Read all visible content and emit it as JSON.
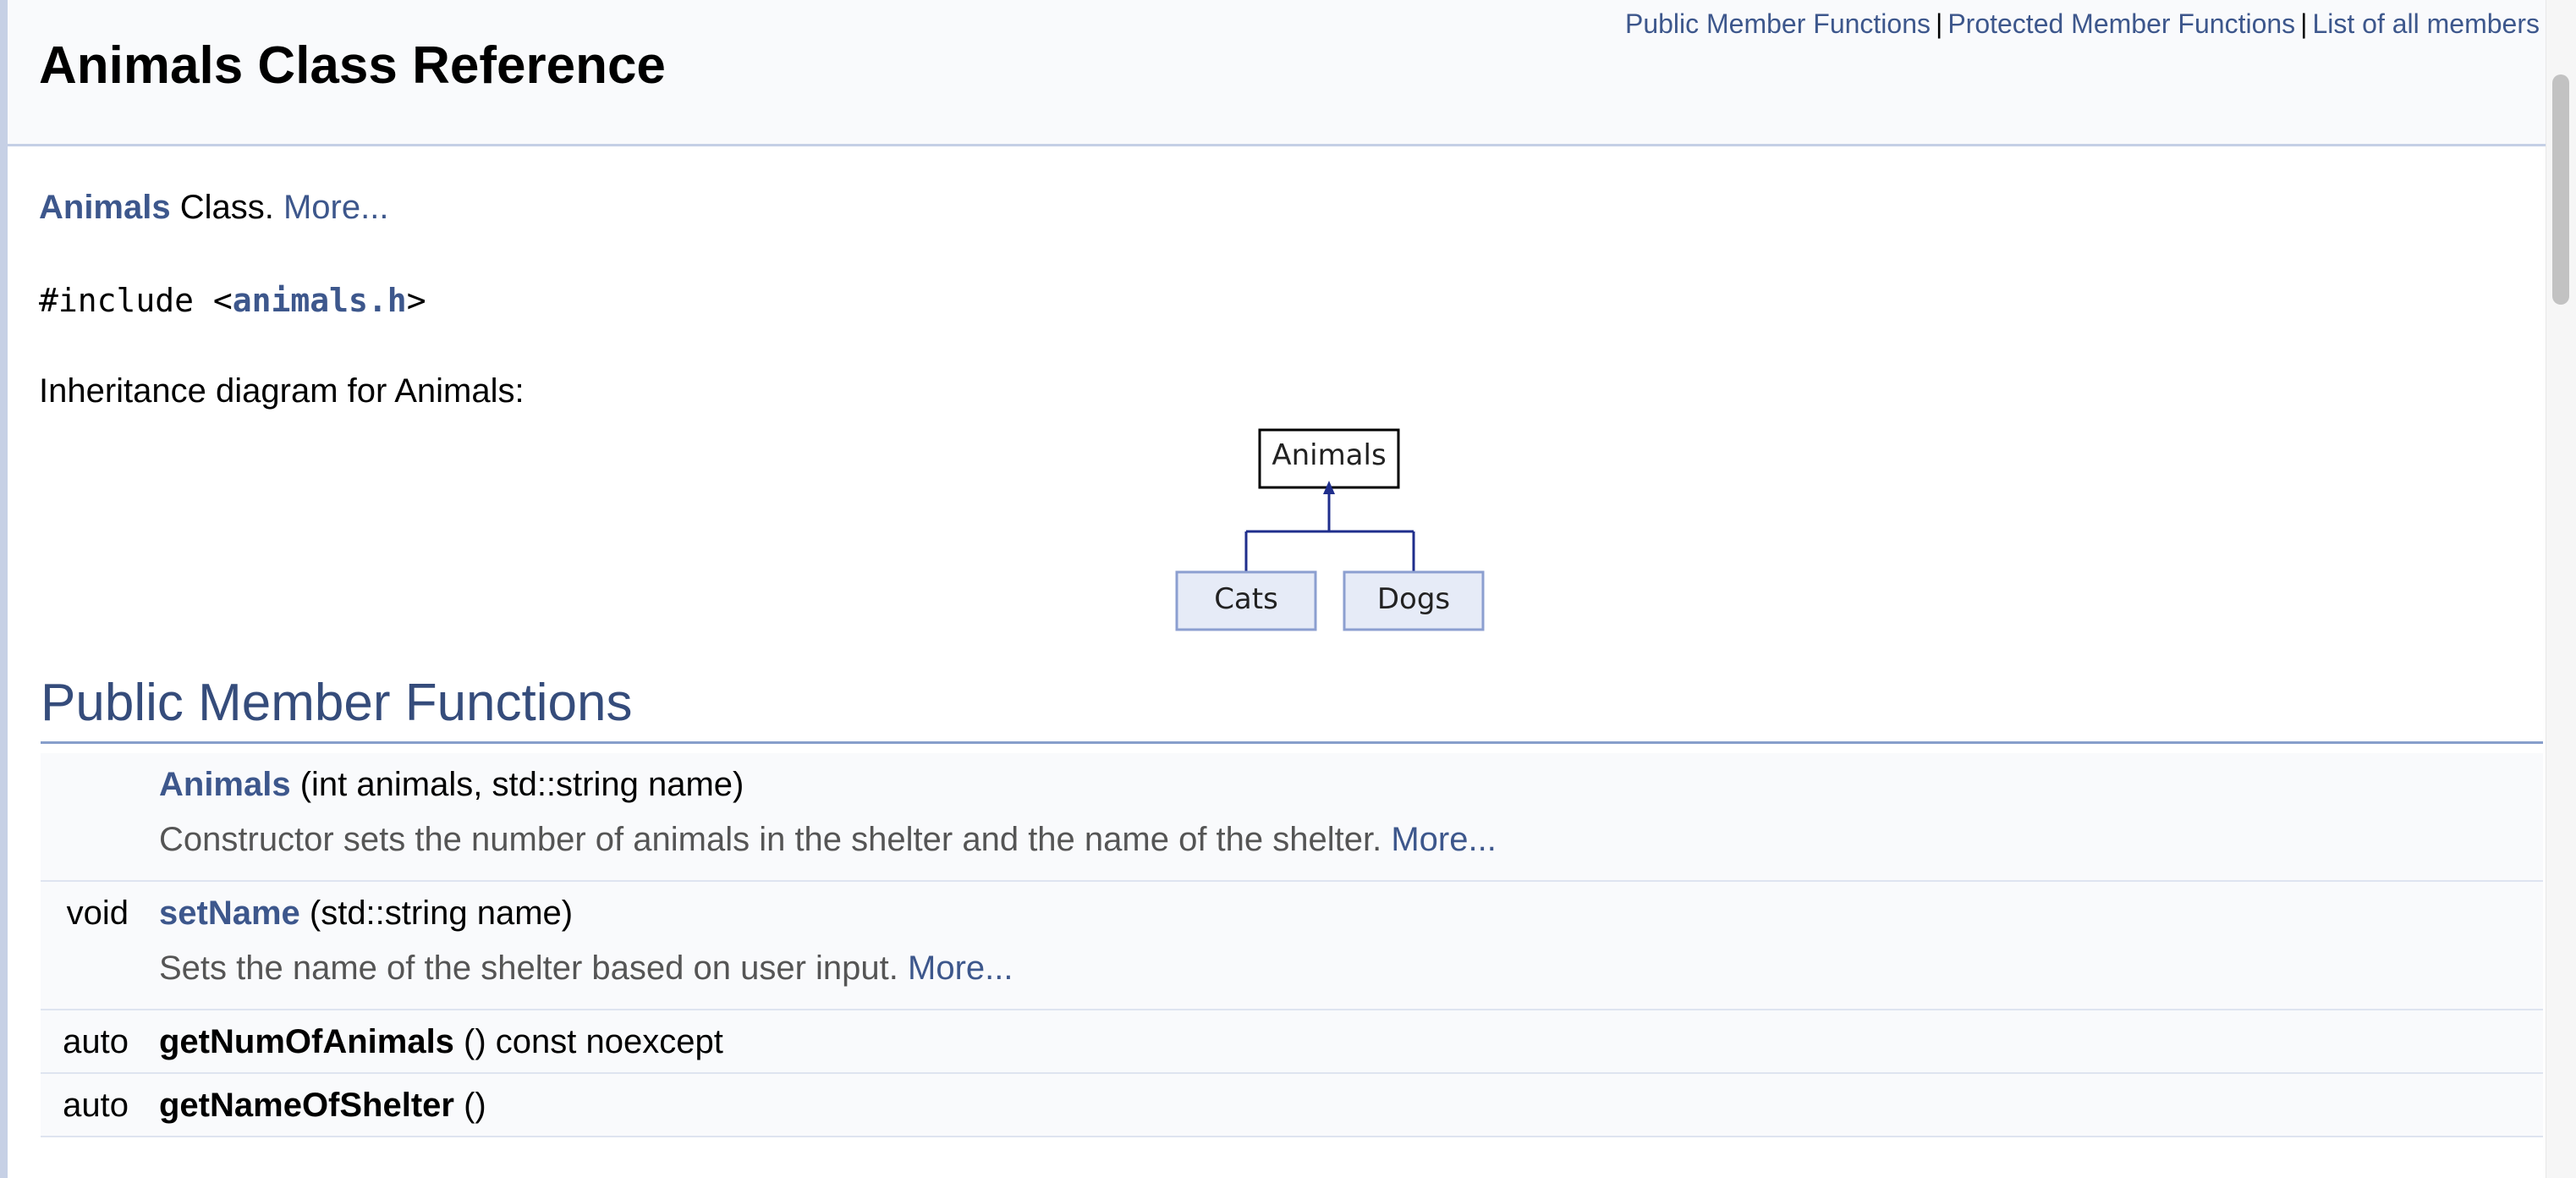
{
  "nav": {
    "links": [
      "Public Member Functions",
      "Protected Member Functions",
      "List of all members"
    ],
    "separator": "|"
  },
  "header": {
    "title": "Animals Class Reference"
  },
  "brief": {
    "class_name": "Animals",
    "text": " Class. ",
    "more": "More..."
  },
  "include": {
    "prefix": "#include <",
    "file": "animals.h",
    "suffix": ">"
  },
  "inheritance": {
    "label": "Inheritance diagram for Animals:",
    "base": "Animals",
    "derived": [
      "Cats",
      "Dogs"
    ]
  },
  "section": {
    "title": "Public Member Functions"
  },
  "members": [
    {
      "type": "",
      "name": "Animals",
      "params": " (int animals, std::string name)",
      "desc": "Constructor sets the number of animals in the shelter and the name of the shelter. ",
      "more": "More..."
    },
    {
      "type": "void",
      "name": "setName",
      "params": " (std::string name)",
      "desc": "Sets the name of the shelter based on user input. ",
      "more": "More..."
    },
    {
      "type": "auto",
      "name": "getNumOfAnimals",
      "params": " () const noexcept"
    },
    {
      "type": "auto",
      "name": "getNameOfShelter",
      "params": " ()"
    }
  ],
  "colors": {
    "link": "#3d578c",
    "section_title": "#354c7b",
    "header_bg": "#f9fafc",
    "diagram_box_bg": "#e6ebf7",
    "diagram_line": "#1f2e8c"
  }
}
